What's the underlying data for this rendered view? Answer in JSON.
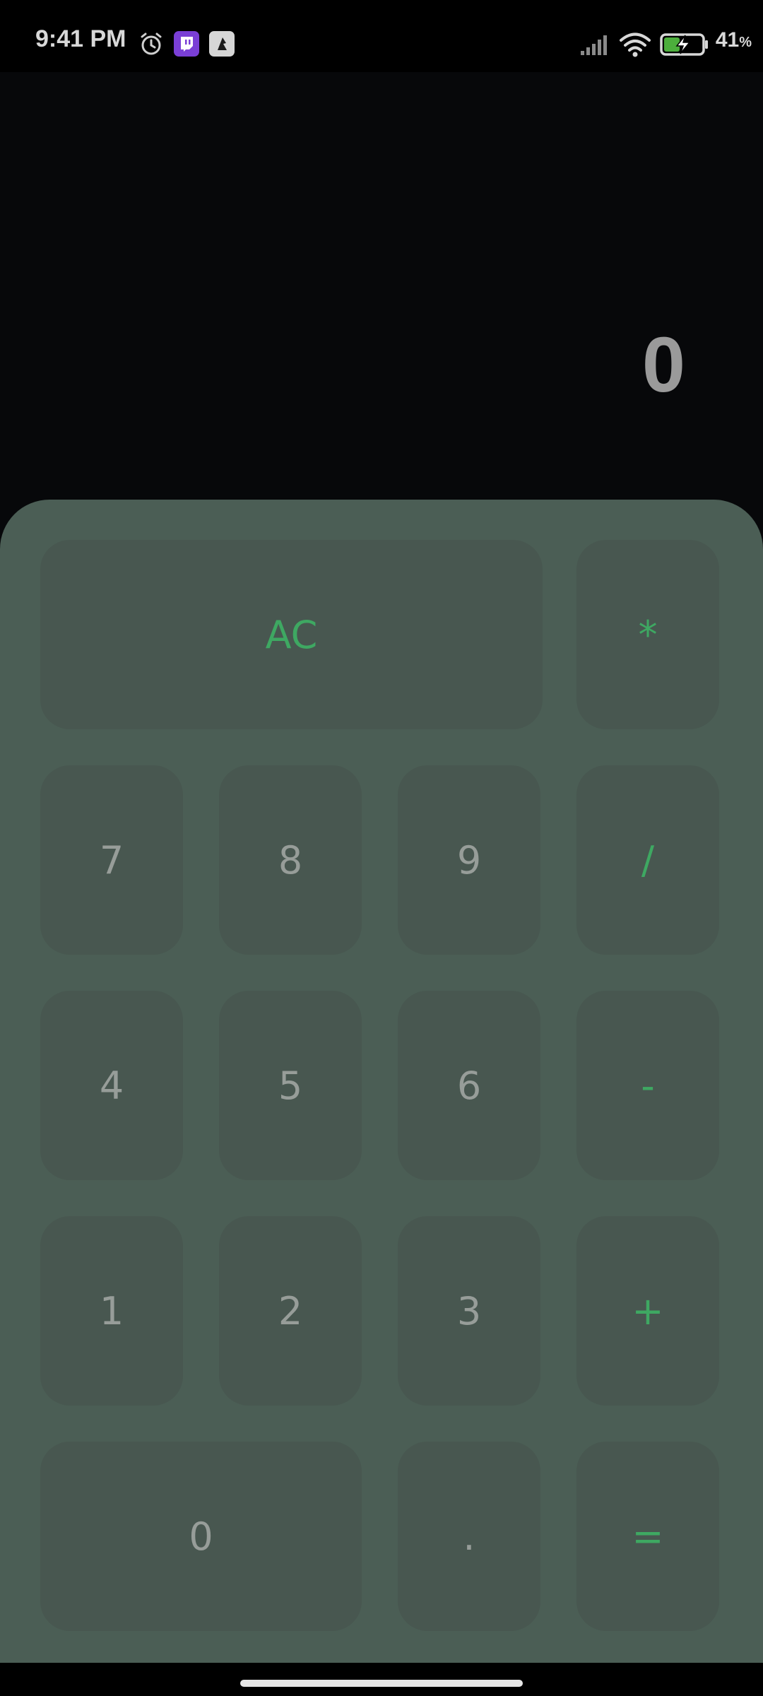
{
  "status_bar": {
    "time": "9:41 PM",
    "battery_percent": "41",
    "battery_unit": "%",
    "icons": [
      "alarm-icon",
      "twitch-icon",
      "app-icon",
      "signal-icon",
      "wifi-icon",
      "battery-charging-icon"
    ]
  },
  "display": {
    "value": "0"
  },
  "keys": {
    "clear": "AC",
    "multiply": "*",
    "seven": "7",
    "eight": "8",
    "nine": "9",
    "divide": "/",
    "four": "4",
    "five": "5",
    "six": "6",
    "subtract": "-",
    "one": "1",
    "two": "2",
    "three": "3",
    "add": "+",
    "zero": "0",
    "decimal": ".",
    "equals": "="
  },
  "colors": {
    "background": "#07080a",
    "keypad_background": "#4b5e55",
    "key_background": "#485750",
    "digit_text": "#979d99",
    "operator_text": "#3ea862",
    "display_text": "#9a9a9a"
  }
}
